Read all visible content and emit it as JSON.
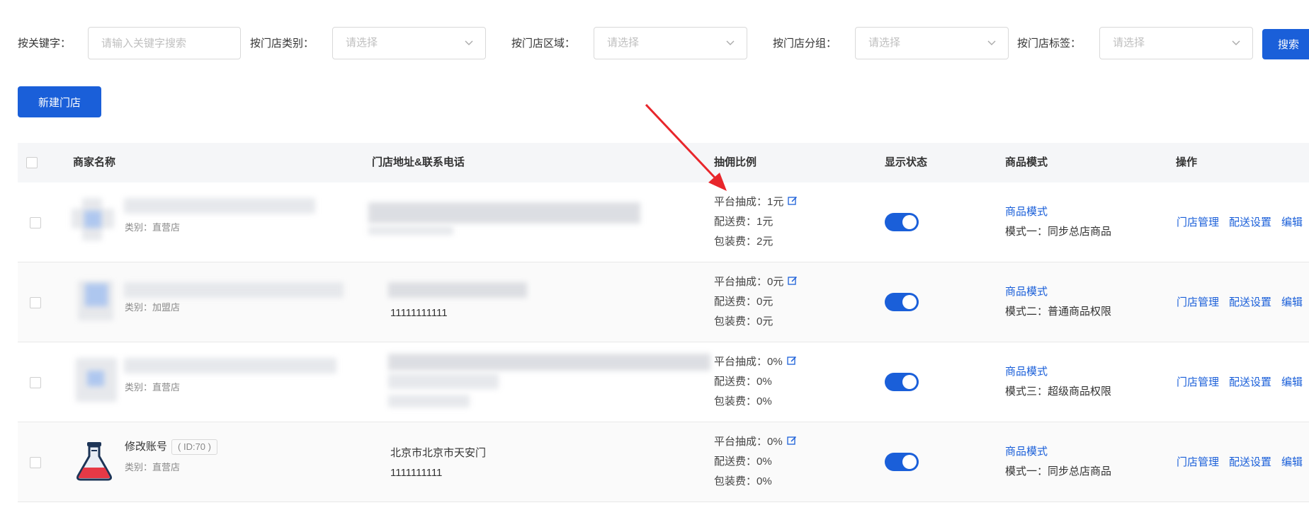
{
  "filters": {
    "keyword_label": "按关键字：",
    "keyword_placeholder": "请输入关键字搜索",
    "category_label": "按门店类别：",
    "category_placeholder": "请选择",
    "region_label": "按门店区域：",
    "region_placeholder": "请选择",
    "group_label": "按门店分组：",
    "group_placeholder": "请选择",
    "tag_label": "按门店标签：",
    "tag_placeholder": "请选择",
    "search_label": "搜索"
  },
  "toolbar": {
    "new_store_label": "新建门店"
  },
  "table": {
    "headers": {
      "merchant": "商家名称",
      "address": "门店地址&联系电话",
      "commission": "抽佣比例",
      "status": "显示状态",
      "product_mode": "商品模式",
      "actions": "操作"
    },
    "rows": [
      {
        "category": "类别：直营店",
        "phone": "",
        "commission": {
          "platform": "平台抽成：1元",
          "delivery": "配送费：1元",
          "packing": "包装费：2元"
        },
        "status_on": true,
        "mode_link": "商品模式",
        "mode_value": "模式一：同步总店商品",
        "actions": [
          "门店管理",
          "配送设置",
          "编辑"
        ]
      },
      {
        "category": "类别：加盟店",
        "phone": "11111111111",
        "commission": {
          "platform": "平台抽成：0元",
          "delivery": "配送费：0元",
          "packing": "包装费：0元"
        },
        "status_on": true,
        "mode_link": "商品模式",
        "mode_value": "模式二：普通商品权限",
        "actions": [
          "门店管理",
          "配送设置",
          "编辑"
        ]
      },
      {
        "category": "类别：直营店",
        "phone": "",
        "commission": {
          "platform": "平台抽成：0%",
          "delivery": "配送费：0%",
          "packing": "包装费：0%"
        },
        "status_on": true,
        "mode_link": "商品模式",
        "mode_value": "模式三：超级商品权限",
        "actions": [
          "门店管理",
          "配送设置",
          "编辑"
        ]
      },
      {
        "name": "修改账号",
        "id_tag": "( ID:70 )",
        "category": "类别：直营店",
        "address": "北京市北京市天安门",
        "phone": "1111111111",
        "commission": {
          "platform": "平台抽成：0%",
          "delivery": "配送费：0%",
          "packing": "包装费：0%"
        },
        "status_on": true,
        "mode_link": "商品模式",
        "mode_value": "模式一：同步总店商品",
        "actions": [
          "门店管理",
          "配送设置",
          "编辑"
        ]
      }
    ]
  },
  "colors": {
    "primary": "#1a5fd9",
    "annotation_arrow": "#e8262b"
  }
}
